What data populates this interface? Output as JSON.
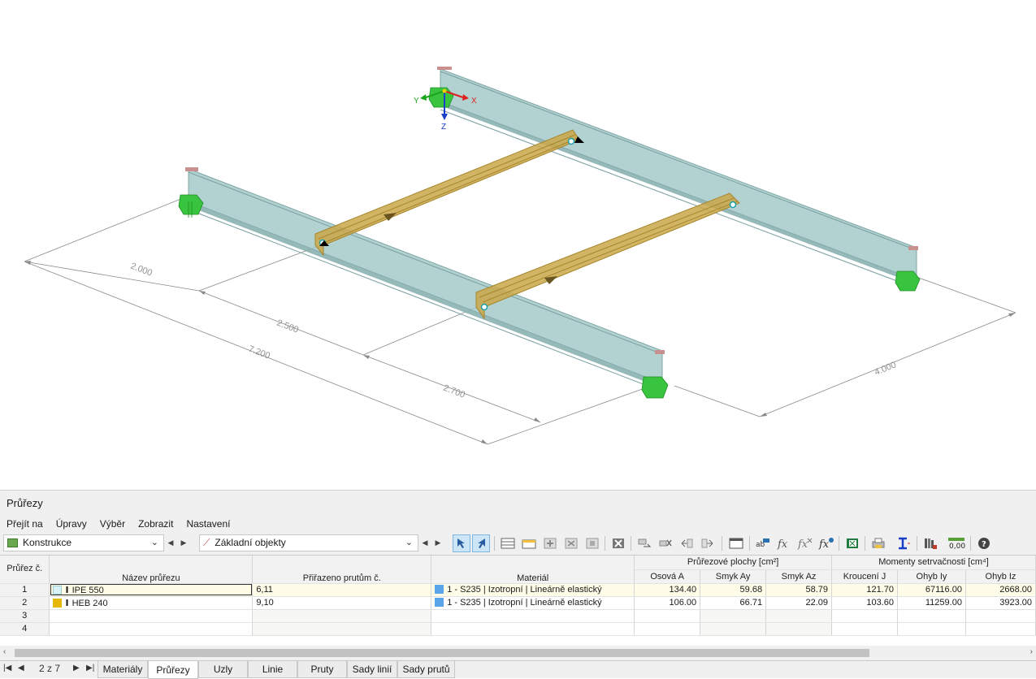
{
  "viewport": {
    "axes": {
      "x": "X",
      "y": "Y",
      "z": "Z"
    },
    "dimensions": [
      "2.000",
      "2.500",
      "7.200",
      "2.700",
      "4.000"
    ]
  },
  "panel": {
    "title": "Průřezy",
    "menu": [
      "Přejít na",
      "Úpravy",
      "Výběr",
      "Zobrazit",
      "Nastavení"
    ],
    "combo_left": "Konstrukce",
    "combo_right": "Základní objekty",
    "icons": [
      "select-icon",
      "select-alt-icon",
      "table-icon",
      "table-add-icon",
      "insert-row-icon",
      "copy-row-icon",
      "delete-row-icon",
      "clear-icon",
      "export-icon",
      "remove-icon",
      "move-left-icon",
      "move-right-icon",
      "window-icon",
      "text-format-icon",
      "formula-icon",
      "formula-delete-icon",
      "formula-settings-icon",
      "excel-icon",
      "print-icon",
      "section-icon",
      "library-icon",
      "number-format-icon",
      "help-icon"
    ]
  },
  "table": {
    "group_headers": {
      "areas": "Průřezové plochy [cm²]",
      "moments": "Momenty setrvačnosti [cm⁴]"
    },
    "headers": {
      "no": "Průřez č.",
      "name": "Název průřezu",
      "assigned": "Přiřazeno prutům č.",
      "material": "Materiál",
      "axial": "Osová A",
      "shear_y": "Smyk Ay",
      "shear_z": "Smyk Az",
      "torsion": "Kroucení J",
      "bend_y": "Ohyb Iy",
      "bend_z": "Ohyb Iz"
    },
    "rows": [
      {
        "no": "1",
        "color": "#d8f3f6",
        "name": "IPE 550",
        "assigned": "6,11",
        "mat_color": "#5aa4ea",
        "material": "1 - S235 | Izotropní | Lineárně elastický",
        "axial": "134.40",
        "shear_y": "59.68",
        "shear_z": "58.79",
        "torsion": "121.70",
        "bend_y": "67116.00",
        "bend_z": "2668.00"
      },
      {
        "no": "2",
        "color": "#e6b800",
        "name": "HEB 240",
        "assigned": "9,10",
        "mat_color": "#5aa4ea",
        "material": "1 - S235 | Izotropní | Lineárně elastický",
        "axial": "106.00",
        "shear_y": "66.71",
        "shear_z": "22.09",
        "torsion": "103.60",
        "bend_y": "11259.00",
        "bend_z": "3923.00"
      },
      {
        "no": "3"
      },
      {
        "no": "4"
      }
    ]
  },
  "pager": {
    "label": "2 z 7"
  },
  "tabs": [
    "Materiály",
    "Průřezy",
    "Uzly",
    "Linie",
    "Pruty",
    "Sady linií",
    "Sady prutů"
  ],
  "active_tab": "Průřezy"
}
